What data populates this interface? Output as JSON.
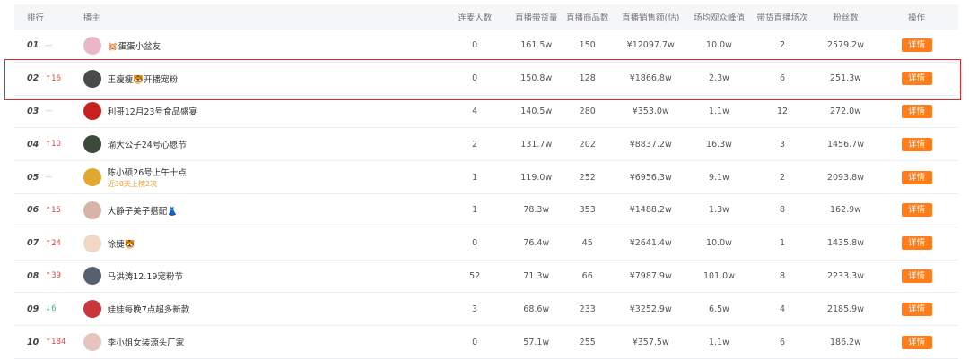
{
  "header": {
    "rank": "排行",
    "anchor": "播主",
    "link_count": "连麦人数",
    "live_sales": "直播带货量",
    "product_count": "直播商品数",
    "live_revenue": "直播销售额(估)",
    "avg_peak": "场均观众峰值",
    "live_sessions": "带货直播场次",
    "fans": "粉丝数",
    "action": "操作"
  },
  "detail_label": "详情",
  "colors": {
    "accent": "#ff7d1a",
    "up": "#e8433a",
    "down": "#36b37e",
    "highlight_border": "#e02828"
  },
  "rows": [
    {
      "rank": "01",
      "change": "—",
      "dir": "same",
      "name": "🐹蛋蛋小盆友",
      "sub": "",
      "avatar": "#e9b7c6",
      "link_count": "0",
      "live_sales": "161.5w",
      "product_count": "150",
      "live_revenue": "¥12097.7w",
      "avg_peak": "10.0w",
      "live_sessions": "2",
      "fans": "2579.2w"
    },
    {
      "rank": "02",
      "change": "↑16",
      "dir": "up",
      "name": "王瘦瘦🐯开播宠粉",
      "sub": "",
      "avatar": "#4a4a4a",
      "link_count": "0",
      "live_sales": "150.8w",
      "product_count": "128",
      "live_revenue": "¥1866.8w",
      "avg_peak": "2.3w",
      "live_sessions": "6",
      "fans": "251.3w"
    },
    {
      "rank": "03",
      "change": "—",
      "dir": "same",
      "name": "利哥12月23号食品盛宴",
      "sub": "",
      "avatar": "#c8201e",
      "link_count": "4",
      "live_sales": "140.5w",
      "product_count": "280",
      "live_revenue": "¥353.0w",
      "avg_peak": "1.1w",
      "live_sessions": "12",
      "fans": "272.0w"
    },
    {
      "rank": "04",
      "change": "↑10",
      "dir": "up",
      "name": "瑜大公子24号心愿节",
      "sub": "",
      "avatar": "#3b4a3b",
      "link_count": "2",
      "live_sales": "131.7w",
      "product_count": "202",
      "live_revenue": "¥8837.2w",
      "avg_peak": "16.3w",
      "live_sessions": "3",
      "fans": "1456.7w"
    },
    {
      "rank": "05",
      "change": "—",
      "dir": "same",
      "name": "陈小硕26号上午十点",
      "sub": "近30天上榜2次",
      "avatar": "#e0a830",
      "link_count": "1",
      "live_sales": "119.0w",
      "product_count": "252",
      "live_revenue": "¥6956.3w",
      "avg_peak": "9.1w",
      "live_sessions": "2",
      "fans": "2093.8w"
    },
    {
      "rank": "06",
      "change": "↑15",
      "dir": "up",
      "name": "大静子美子搭配👗",
      "sub": "",
      "avatar": "#d9b3a6",
      "link_count": "1",
      "live_sales": "78.3w",
      "product_count": "353",
      "live_revenue": "¥1488.2w",
      "avg_peak": "1.3w",
      "live_sessions": "8",
      "fans": "162.9w"
    },
    {
      "rank": "07",
      "change": "↑24",
      "dir": "up",
      "name": "徐婕🐯",
      "sub": "",
      "avatar": "#f1d7c4",
      "link_count": "0",
      "live_sales": "76.4w",
      "product_count": "45",
      "live_revenue": "¥2641.4w",
      "avg_peak": "10.0w",
      "live_sessions": "1",
      "fans": "1435.8w"
    },
    {
      "rank": "08",
      "change": "↑39",
      "dir": "up",
      "name": "马洪涛12.19宠粉节",
      "sub": "",
      "avatar": "#56606e",
      "link_count": "52",
      "live_sales": "71.3w",
      "product_count": "66",
      "live_revenue": "¥7987.9w",
      "avg_peak": "101.0w",
      "live_sessions": "8",
      "fans": "2233.3w"
    },
    {
      "rank": "09",
      "change": "↓6",
      "dir": "down",
      "name": "娃娃每晚7点超多新款",
      "sub": "",
      "avatar": "#c9373a",
      "link_count": "3",
      "live_sales": "68.6w",
      "product_count": "233",
      "live_revenue": "¥3252.9w",
      "avg_peak": "6.5w",
      "live_sessions": "4",
      "fans": "2185.9w"
    },
    {
      "rank": "10",
      "change": "↑184",
      "dir": "up",
      "name": "李小姐女装源头厂家",
      "sub": "",
      "avatar": "#e6c4c0",
      "link_count": "0",
      "live_sales": "57.1w",
      "product_count": "255",
      "live_revenue": "¥357.5w",
      "avg_peak": "1.1w",
      "live_sessions": "6",
      "fans": "186.2w"
    }
  ]
}
